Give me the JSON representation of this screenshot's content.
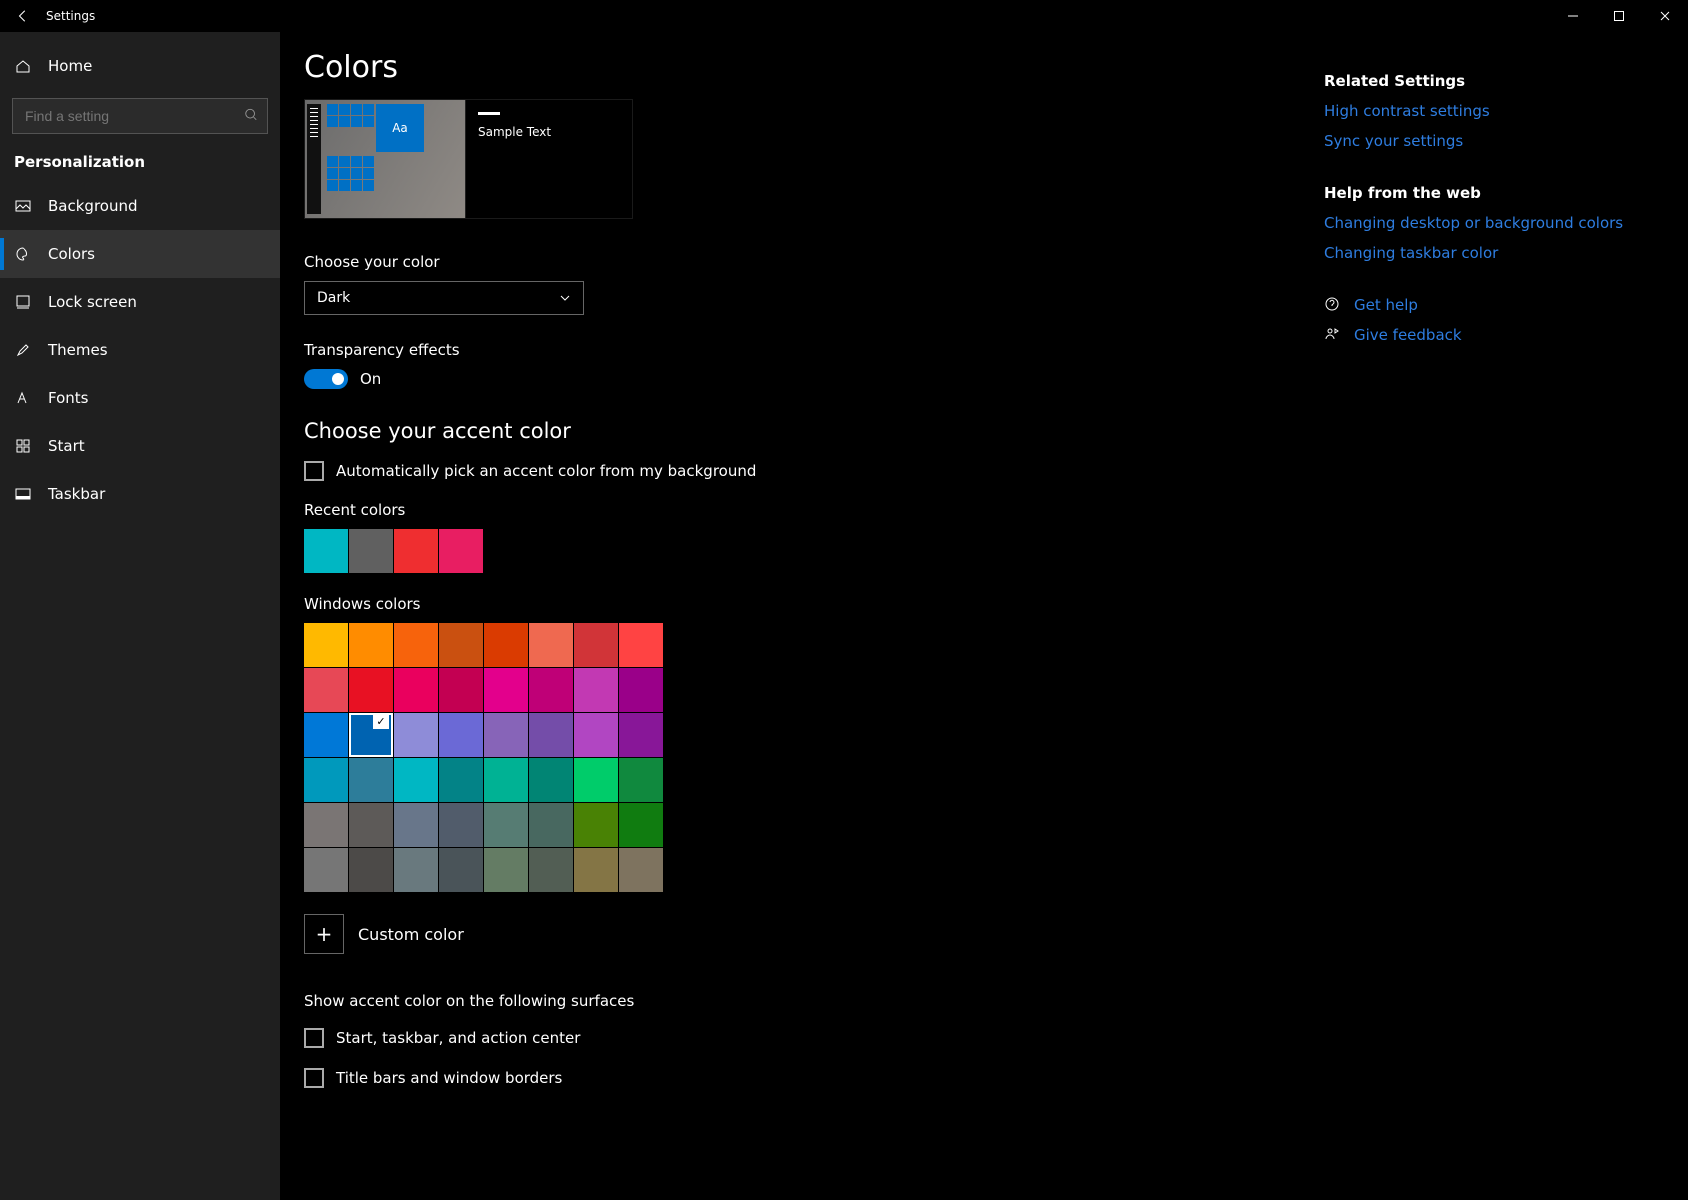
{
  "titlebar": {
    "title": "Settings"
  },
  "sidebar": {
    "home": "Home",
    "search_placeholder": "Find a setting",
    "category": "Personalization",
    "items": [
      {
        "label": "Background"
      },
      {
        "label": "Colors"
      },
      {
        "label": "Lock screen"
      },
      {
        "label": "Themes"
      },
      {
        "label": "Fonts"
      },
      {
        "label": "Start"
      },
      {
        "label": "Taskbar"
      }
    ]
  },
  "page": {
    "title": "Colors",
    "preview_sample": "Sample Text",
    "preview_tile_letters": "Aa",
    "choose_color_label": "Choose your color",
    "choose_color_value": "Dark",
    "transparency_label": "Transparency effects",
    "transparency_state": "On",
    "accent_heading": "Choose your accent color",
    "auto_pick_label": "Automatically pick an accent color from my background",
    "recent_label": "Recent colors",
    "recent_colors": [
      "#00b7c3",
      "#606060",
      "#ef2e30",
      "#e81e62"
    ],
    "windows_label": "Windows colors",
    "windows_colors": [
      "#ffb900",
      "#ff8c00",
      "#f7630c",
      "#ca5010",
      "#da3b01",
      "#ef6950",
      "#d13438",
      "#ff4343",
      "#e74856",
      "#e81123",
      "#ea005e",
      "#c30052",
      "#e3008c",
      "#bf0077",
      "#c239b3",
      "#9a0089",
      "#0078d7",
      "#0063b1",
      "#8e8cd8",
      "#6b69d6",
      "#8764b8",
      "#744da9",
      "#b146c2",
      "#881798",
      "#0099bc",
      "#2d7d9a",
      "#00b7c3",
      "#038387",
      "#00b294",
      "#018574",
      "#00cc6a",
      "#10893e",
      "#7a7574",
      "#5d5a58",
      "#68768a",
      "#515c6b",
      "#567c73",
      "#486860",
      "#498205",
      "#107c10",
      "#767676",
      "#4c4a48",
      "#69797e",
      "#4a5459",
      "#647c64",
      "#525e54",
      "#847545",
      "#7e735f"
    ],
    "selected_windows_color_index": 17,
    "custom_color_label": "Custom color",
    "surfaces_heading": "Show accent color on the following surfaces",
    "surface_start": "Start, taskbar, and action center",
    "surface_titlebars": "Title bars and window borders"
  },
  "right": {
    "related_heading": "Related Settings",
    "related_links": [
      "High contrast settings",
      "Sync your settings"
    ],
    "help_heading": "Help from the web",
    "help_links": [
      "Changing desktop or background colors",
      "Changing taskbar color"
    ],
    "get_help": "Get help",
    "give_feedback": "Give feedback"
  }
}
